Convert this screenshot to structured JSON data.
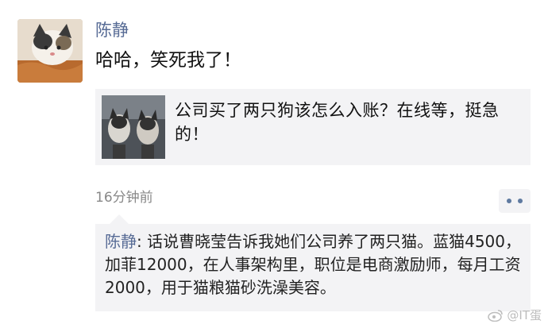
{
  "post": {
    "author": "陈静",
    "text": "哈哈，笑死我了！",
    "avatar_icon": "cat-photo-icon"
  },
  "shared_link": {
    "title": "公司买了两只狗该怎么入账？在线等，挺急的！",
    "thumbnail_icon": "dogs-photo-icon"
  },
  "meta": {
    "timestamp": "16分钟前",
    "more_icon": "more-dots-icon"
  },
  "comment": {
    "author": "陈静",
    "separator": ": ",
    "text": "话说曹晓莹告诉我她们公司养了两只猫。蓝猫4500，加菲12000，在人事架构里，职位是电商激励师，每月工资2000，用于猫粮猫砂洗澡美容。"
  },
  "watermark": {
    "text": "@IT蛋",
    "icon": "weibo-icon"
  },
  "colors": {
    "link": "#576b95",
    "card_bg": "#f3f3f5",
    "timestamp": "#888888"
  }
}
